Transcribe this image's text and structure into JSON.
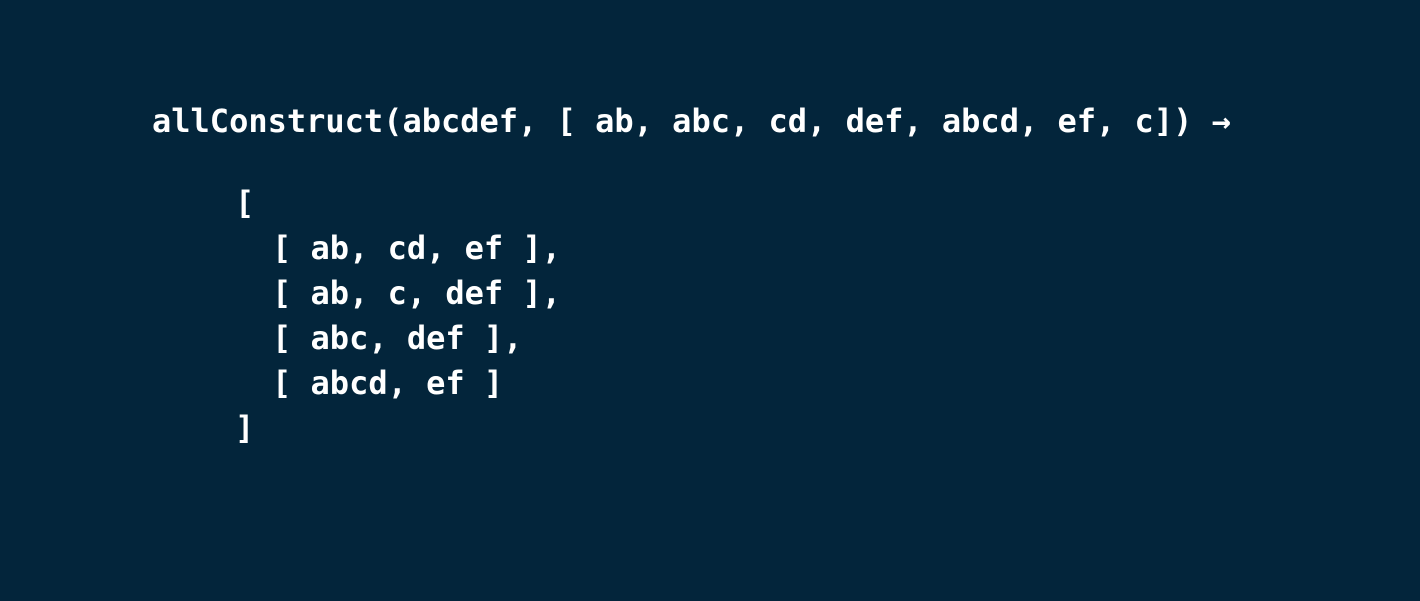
{
  "slide": {
    "call_expression": "allConstruct(abcdef, [ ab, abc, cd, def, abcd, ef, c]) →",
    "result": {
      "open_bracket": "[",
      "rows": [
        "[ ab, cd, ef ],",
        "[ ab, c, def ],",
        "[ abc, def ],",
        "[ abcd, ef ]"
      ],
      "close_bracket": "]"
    }
  }
}
